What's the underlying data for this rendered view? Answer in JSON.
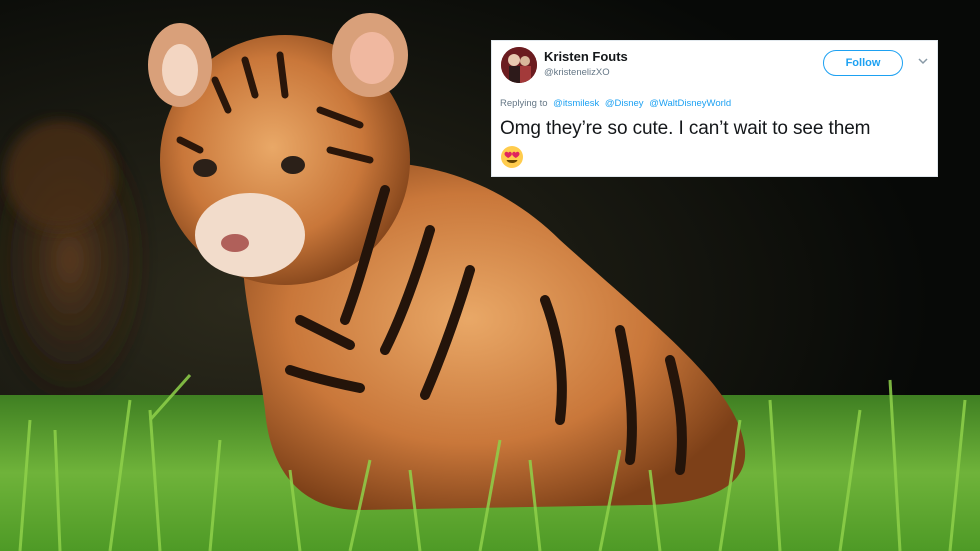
{
  "scene": {
    "description_icon": "tiger-cub-photo"
  },
  "tweet": {
    "display_name": "Kristen Fouts",
    "handle": "@kristenelizXO",
    "follow_label": "Follow",
    "replying_prefix": "Replying to",
    "mentions": [
      "@itsmilesk",
      "@Disney",
      "@WaltDisneyWorld"
    ],
    "text": "Omg they’re so cute. I can’t wait to see them",
    "emoji_icon": "heart-eyes-emoji",
    "accent_color": "#1da1f2"
  }
}
